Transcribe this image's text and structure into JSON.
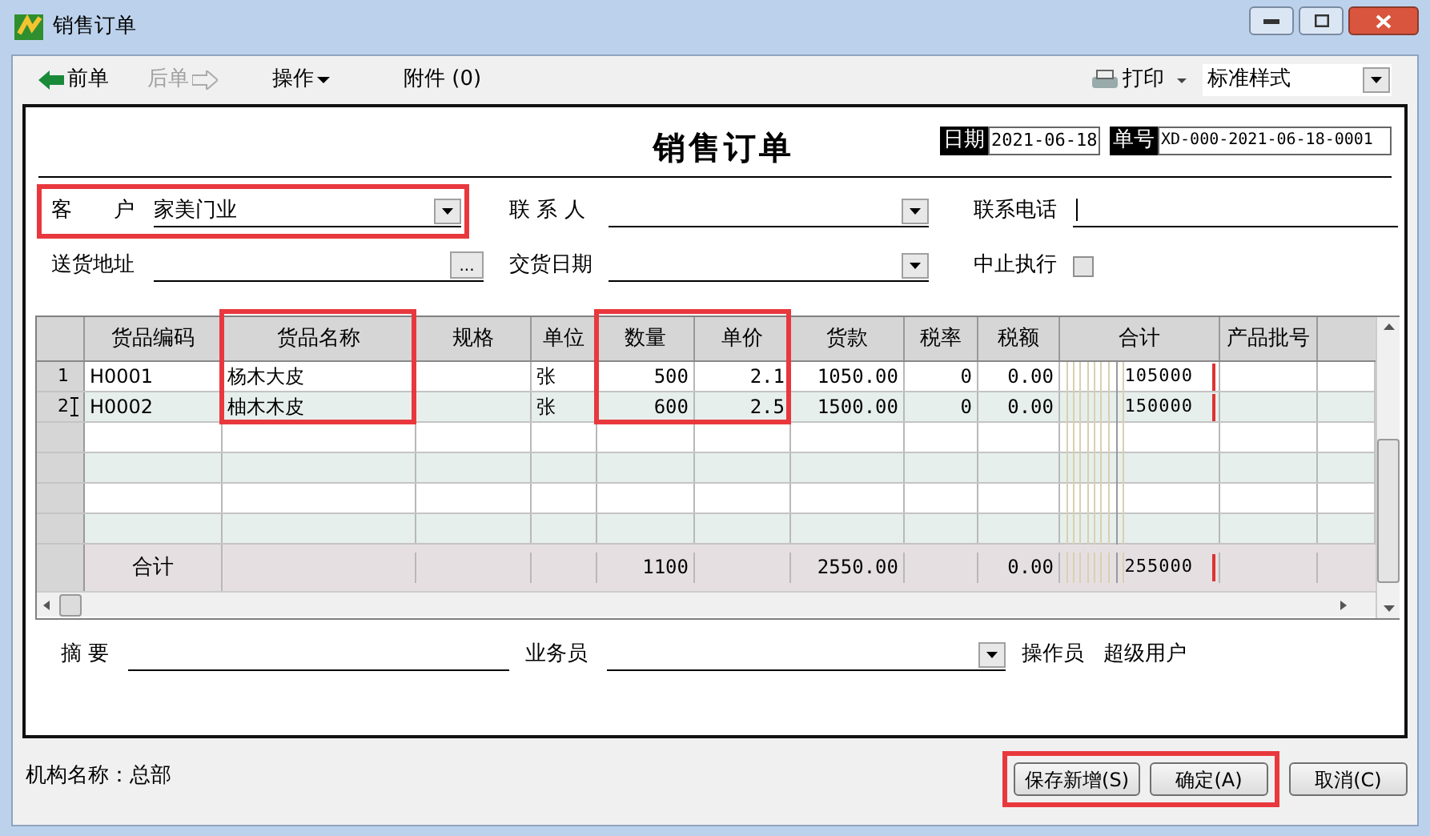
{
  "window": {
    "title": "销售订单"
  },
  "toolbar": {
    "items": [
      {
        "label": "前单",
        "kind": "prev",
        "disabled": false
      },
      {
        "label": "后单",
        "kind": "next",
        "disabled": true
      },
      {
        "label": "操作",
        "kind": "menu",
        "disabled": false
      },
      {
        "label": "附件 (0)",
        "kind": "plain",
        "disabled": false
      }
    ],
    "print": "打印",
    "style_select": "标准样式"
  },
  "form": {
    "title": "销售订单",
    "date_label": "日期",
    "date": "2021-06-18",
    "number_label": "单号",
    "number": "XD-000-2021-06-18-0001",
    "fields": [
      {
        "label": "客　　户",
        "value": "家美门业",
        "kind": "dropdown",
        "highlighted": true
      },
      {
        "label": "联 系 人",
        "kind": "dropdown",
        "highlighted": false
      },
      {
        "label": "联系电话",
        "kind": "text",
        "highlighted": false
      },
      {
        "label": "送货地址",
        "kind": "browse",
        "browse_label": "...",
        "highlighted": false
      },
      {
        "label": "交货日期",
        "kind": "dropdown",
        "highlighted": false
      },
      {
        "label": "中止执行",
        "kind": "checkbox",
        "checked": false,
        "highlighted": false
      }
    ]
  },
  "grid": {
    "columns": [
      {
        "label": "货品编码",
        "highlighted": false
      },
      {
        "label": "货品名称",
        "highlighted": true
      },
      {
        "label": "规格",
        "highlighted": false
      },
      {
        "label": "单位",
        "highlighted": false
      },
      {
        "label": "数量",
        "highlighted": true
      },
      {
        "label": "单价",
        "highlighted": true
      },
      {
        "label": "货款",
        "highlighted": false
      },
      {
        "label": "税率",
        "highlighted": false
      },
      {
        "label": "税额",
        "highlighted": false
      },
      {
        "label": "合计",
        "highlighted": false
      },
      {
        "label": "产品批号",
        "highlighted": false
      }
    ],
    "rows": [
      {
        "number": "1",
        "selected": false,
        "code": "H0001",
        "name": "杨木大皮",
        "unit": "张",
        "qty": "500",
        "price": "2.1",
        "amount": "1050.00",
        "tax_rate": "0",
        "tax": "0.00",
        "total": "105000"
      },
      {
        "number": "2",
        "selected": true,
        "code": "H0002",
        "name": "柚木木皮",
        "unit": "张",
        "qty": "600",
        "price": "2.5",
        "amount": "1500.00",
        "tax_rate": "0",
        "tax": "0.00",
        "total": "150000"
      }
    ],
    "totals": {
      "label": "合计",
      "qty": "1100",
      "amount": "2550.00",
      "tax": "0.00",
      "total": "255000"
    }
  },
  "footer_fields": [
    {
      "label": "摘 要",
      "kind": "text"
    },
    {
      "label": "业务员",
      "kind": "dropdown"
    },
    {
      "label": "操作员",
      "kind": "static",
      "value": "超级用户"
    }
  ],
  "status_bar": {
    "text": "机构名称：总部"
  },
  "buttons": [
    {
      "label": "保存新增(S)",
      "highlighted": true
    },
    {
      "label": "确定(A)",
      "highlighted": true
    },
    {
      "label": "取消(C)",
      "highlighted": false
    }
  ]
}
